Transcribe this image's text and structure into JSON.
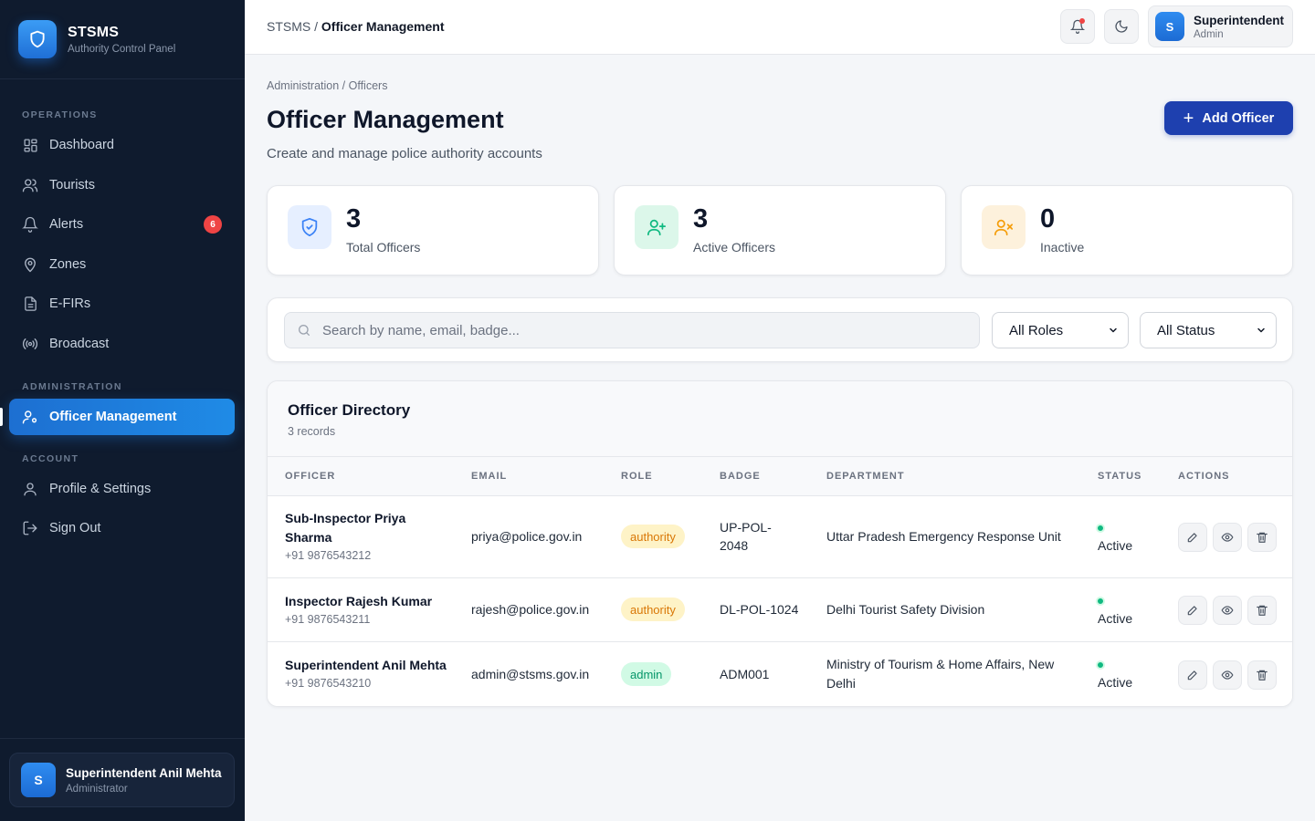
{
  "brand": {
    "name": "STSMS",
    "subtitle": "Authority Control Panel",
    "logo_icon": "shield-icon"
  },
  "sidebar": {
    "sections": {
      "operations": "OPERATIONS",
      "administration": "ADMINISTRATION",
      "account": "ACCOUNT"
    },
    "items": [
      {
        "label": "Dashboard",
        "icon": "dashboard-icon"
      },
      {
        "label": "Tourists",
        "icon": "users-icon"
      },
      {
        "label": "Alerts",
        "icon": "bell-icon",
        "badge": "6"
      },
      {
        "label": "Zones",
        "icon": "map-pin-icon"
      },
      {
        "label": "E-FIRs",
        "icon": "document-icon"
      },
      {
        "label": "Broadcast",
        "icon": "broadcast-icon"
      },
      {
        "label": "Officer Management",
        "icon": "user-cog-icon",
        "active": true
      },
      {
        "label": "Profile & Settings",
        "icon": "user-icon"
      },
      {
        "label": "Sign Out",
        "icon": "sign-out-icon"
      }
    ],
    "user": {
      "initial": "S",
      "name": "Superintendent Anil Mehta",
      "role": "Administrator"
    }
  },
  "topbar": {
    "breadcrumb_root": "STSMS /",
    "breadcrumb_current": "Officer Management",
    "profile": {
      "initial": "S",
      "name": "Superintendent",
      "role": "Admin"
    }
  },
  "page": {
    "breadcrumb": "Administration / Officers",
    "title": "Officer Management",
    "subtitle": "Create and manage police authority accounts",
    "add_button": "Add Officer"
  },
  "stats": [
    {
      "value": "3",
      "label": "Total Officers",
      "icon": "shield-check-icon",
      "color": "#3b82f6"
    },
    {
      "value": "3",
      "label": "Active Officers",
      "icon": "user-plus-icon",
      "color": "#10b981"
    },
    {
      "value": "0",
      "label": "Inactive",
      "icon": "user-x-icon",
      "color": "#f59e0b"
    }
  ],
  "filters": {
    "search_placeholder": "Search by name, email, badge...",
    "role_selected": "All Roles",
    "status_selected": "All Status"
  },
  "directory": {
    "title": "Officer Directory",
    "count": "3 records",
    "columns": [
      "OFFICER",
      "EMAIL",
      "ROLE",
      "BADGE",
      "DEPARTMENT",
      "STATUS",
      "ACTIONS"
    ],
    "rows": [
      {
        "name_line1": "Sub-Inspector Priya",
        "name_line2": "Sharma",
        "phone": "+91 9876543212",
        "email": "priya@police.gov.in",
        "role": "authority",
        "badge_line1": "UP-POL-",
        "badge_line2": "2048",
        "department_line1": "Uttar Pradesh Emergency Response Unit",
        "department_line2": "",
        "status": "Active"
      },
      {
        "name_line1": "Inspector Rajesh Kumar",
        "name_line2": "",
        "phone": "+91 9876543211",
        "email": "rajesh@police.gov.in",
        "role": "authority",
        "badge_line1": "DL-POL-1024",
        "badge_line2": "",
        "department_line1": "Delhi Tourist Safety Division",
        "department_line2": "",
        "status": "Active"
      },
      {
        "name_line1": "Superintendent Anil Mehta",
        "name_line2": "",
        "phone": "+91 9876543210",
        "email": "admin@stsms.gov.in",
        "role": "admin",
        "badge_line1": "ADM001",
        "badge_line2": "",
        "department_line1": "Ministry of Tourism & Home Affairs, New",
        "department_line2": "Delhi",
        "status": "Active"
      }
    ]
  },
  "colors": {
    "sidebar_bg": "#0f1b2e",
    "accent": "#1e40af",
    "active_nav": "#1f8be6",
    "status_active": "#10b981",
    "alert_badge": "#ef4444"
  }
}
